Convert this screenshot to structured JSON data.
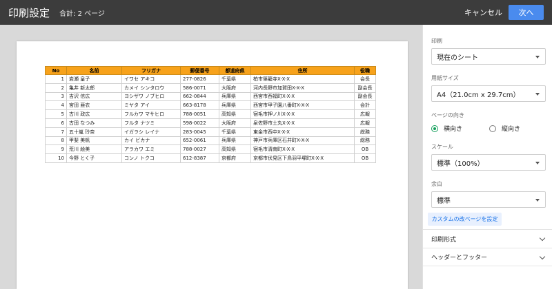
{
  "header": {
    "title": "印刷設定",
    "total": "合計: 2 ページ",
    "cancel_label": "キャンセル",
    "next_label": "次へ"
  },
  "sheet": {
    "columns": [
      "No",
      "名前",
      "フリガナ",
      "郵便番号",
      "都道府県",
      "住所",
      "役職"
    ],
    "rows": [
      [
        "1",
        "岩瀬 皇子",
        "イワセ アキコ",
        "277-0826",
        "千葉県",
        "柏市篠籠寺X-X-X",
        "会長"
      ],
      [
        "2",
        "亀井 新太郎",
        "カメイ シンタロウ",
        "586-0071",
        "大阪府",
        "河内長野市加賀田X-X-X",
        "副会長"
      ],
      [
        "3",
        "吉沢 信広",
        "ヨシザワ ノブヒロ",
        "662-0844",
        "兵庫県",
        "西宮市西福町X-X-X",
        "副会長"
      ],
      [
        "4",
        "宮田 亜衣",
        "ミヤタ アイ",
        "663-8178",
        "兵庫県",
        "西宮市甲子園八番町X-X-X",
        "会計"
      ],
      [
        "5",
        "古川 政広",
        "フルカワ マサヒロ",
        "788-0051",
        "高知県",
        "宿毛市押ノ川X-X-X",
        "広報"
      ],
      [
        "6",
        "古田 なつみ",
        "フルタ ナツミ",
        "598-0022",
        "大阪府",
        "泉佐野市土丸X-X-X",
        "広報"
      ],
      [
        "7",
        "五十嵐 玲奈",
        "イガラシ レイナ",
        "283-0045",
        "千葉県",
        "東金市西中X-X-X",
        "総務"
      ],
      [
        "8",
        "甲斐 美帆",
        "カイ ビカナ",
        "652-0061",
        "兵庫県",
        "神戸市兵庫区石井町X-X-X",
        "総務"
      ],
      [
        "9",
        "荒川 絵美",
        "アラカワ エミ",
        "788-0027",
        "高知県",
        "宿毛市清南町X-X-X",
        "OB"
      ],
      [
        "10",
        "今野 とく子",
        "コンノ トクコ",
        "612-8387",
        "京都府",
        "京都市伏見区下鳥羽平塚町X-X-X",
        "OB"
      ]
    ]
  },
  "panel": {
    "print_label": "印刷",
    "print_value": "現在のシート",
    "paper_label": "用紙サイズ",
    "paper_value": "A4（21.0cm x 29.7cm）",
    "orientation_label": "ページの向き",
    "orientation_landscape": "横向き",
    "orientation_portrait": "縦向き",
    "scale_label": "スケール",
    "scale_value": "標準（100%）",
    "margin_label": "余白",
    "margin_value": "標準",
    "custom_break_label": "カスタムの改ページを設定",
    "section_format": "印刷形式",
    "section_header_footer": "ヘッダーとフッター"
  }
}
